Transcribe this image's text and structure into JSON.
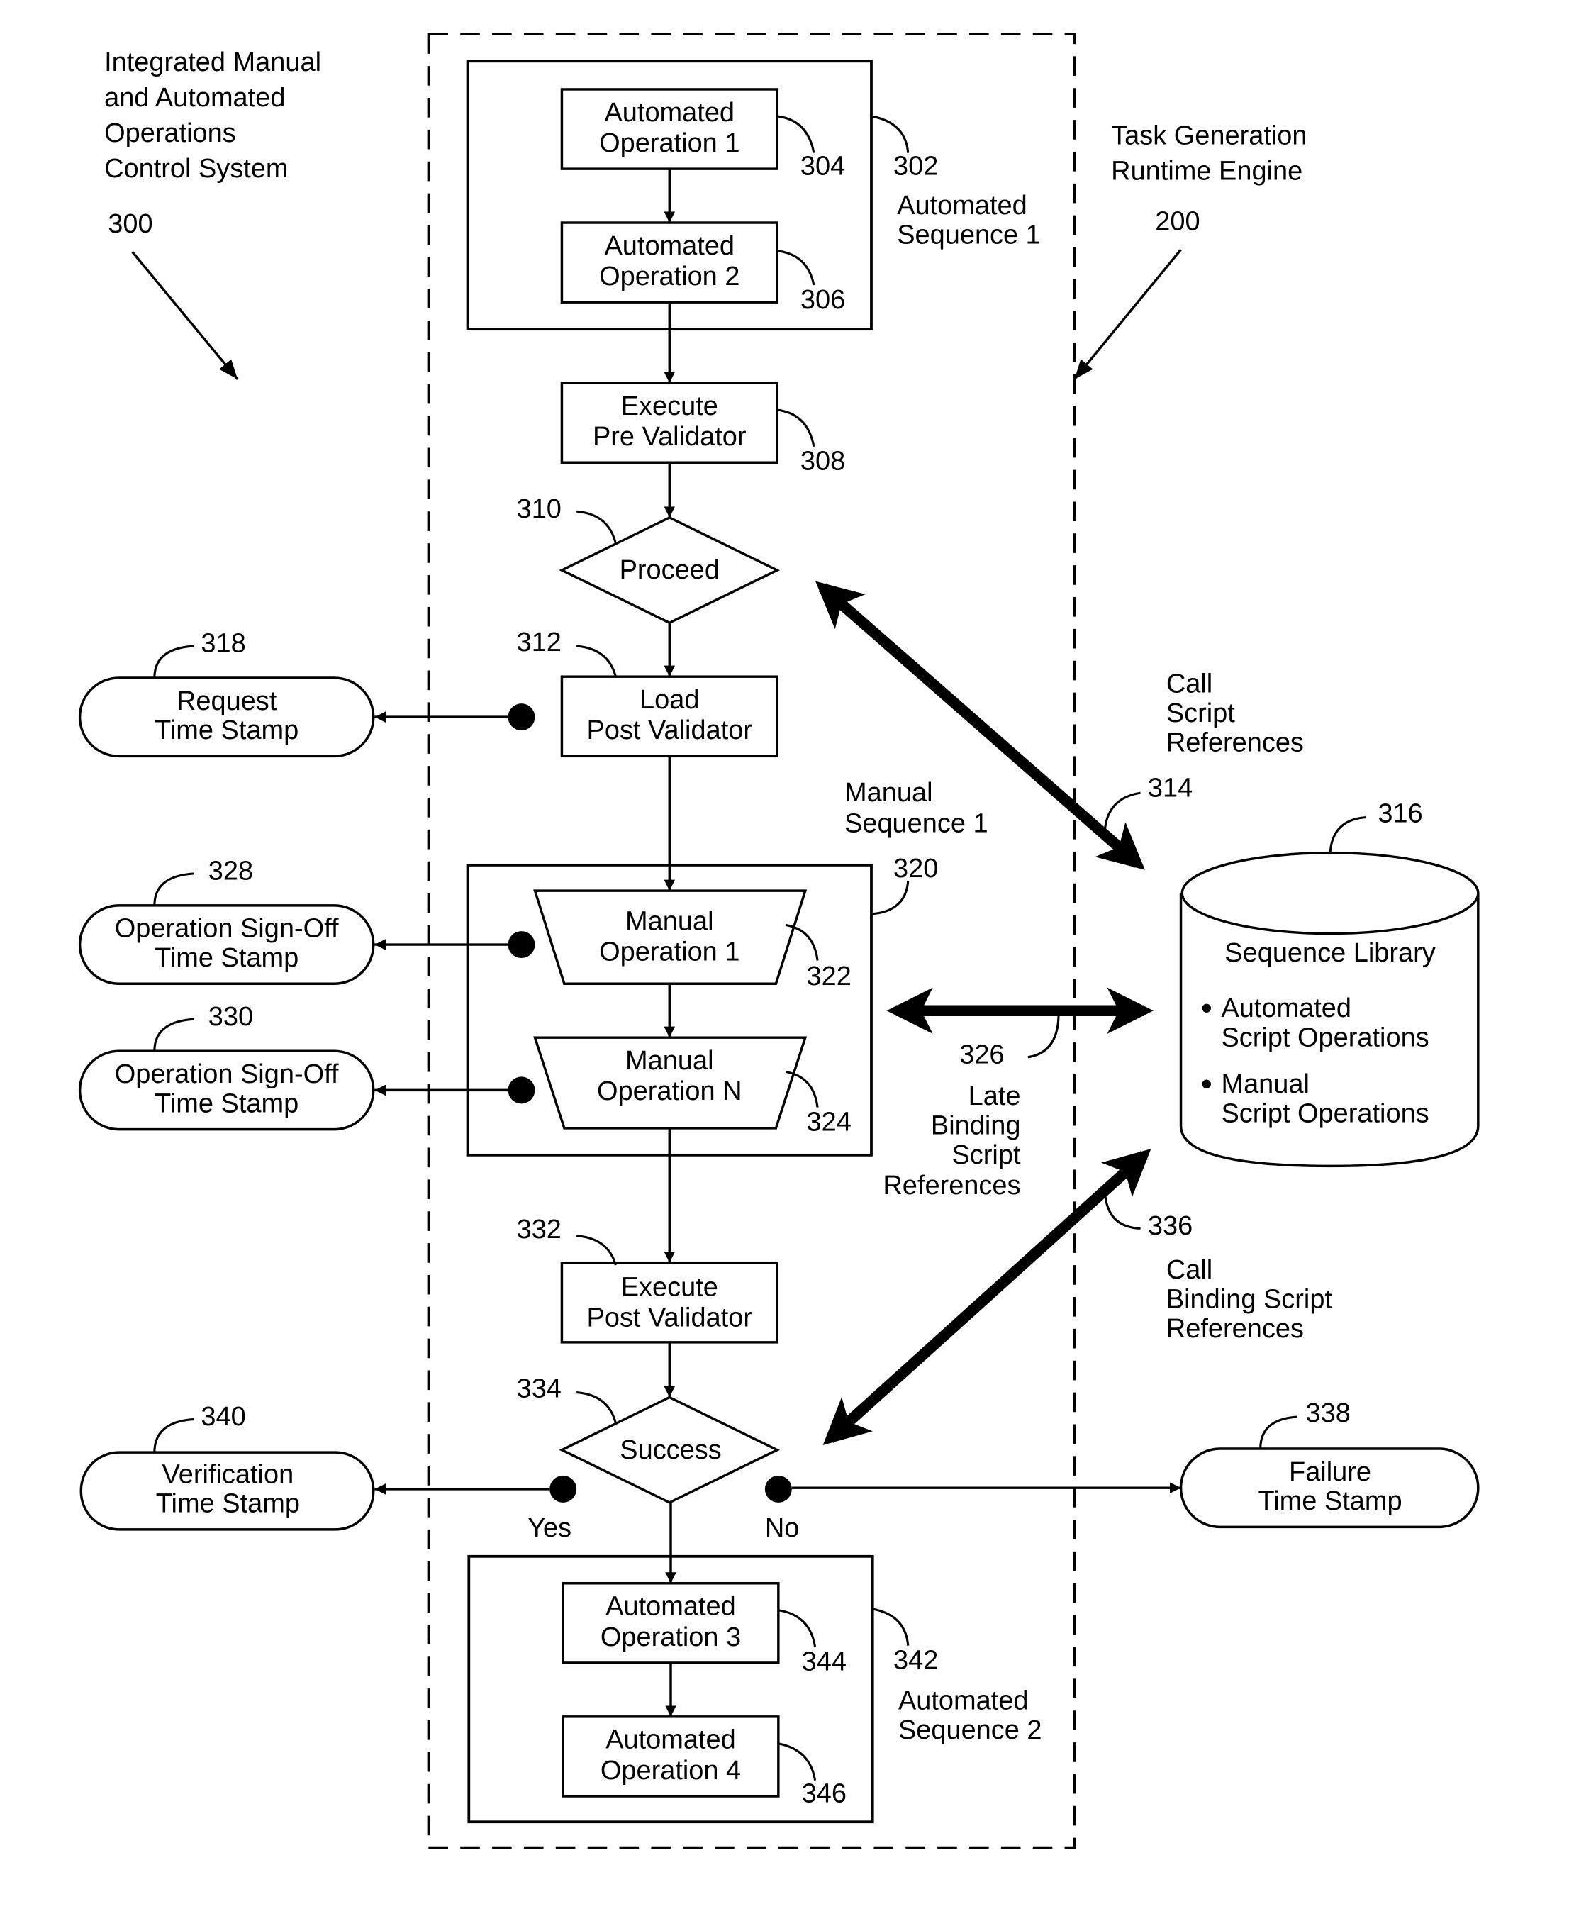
{
  "system_label": {
    "lines": [
      "Integrated Manual",
      "and Automated",
      "Operations",
      "Control System"
    ],
    "ref": "300"
  },
  "engine_label": {
    "lines": [
      "Task Generation",
      "Runtime Engine"
    ],
    "ref": "200"
  },
  "automated_sequence_1": {
    "ref": "302",
    "caption": [
      "Automated",
      "Sequence 1"
    ],
    "op1": {
      "lines": [
        "Automated",
        "Operation 1"
      ],
      "ref": "304"
    },
    "op2": {
      "lines": [
        "Automated",
        "Operation 2"
      ],
      "ref": "306"
    }
  },
  "pre_validator": {
    "lines": [
      "Execute",
      "Pre Validator"
    ],
    "ref": "308"
  },
  "proceed_decision": {
    "label": "Proceed",
    "ref": "310"
  },
  "load_post_validator": {
    "lines": [
      "Load",
      "Post Validator"
    ],
    "ref": "312"
  },
  "call_script_refs": {
    "lines": [
      "Call",
      "Script",
      "References"
    ],
    "ref": "314"
  },
  "sequence_library": {
    "ref": "316",
    "title": "Sequence Library",
    "bullets": [
      [
        "Automated",
        "Script Operations"
      ],
      [
        "Manual",
        "Script Operations"
      ]
    ]
  },
  "request_time_stamp": {
    "lines": [
      "Request",
      "Time Stamp"
    ],
    "ref": "318"
  },
  "manual_sequence_1": {
    "ref": "320",
    "caption": [
      "Manual",
      "Sequence 1"
    ],
    "op1": {
      "lines": [
        "Manual",
        "Operation 1"
      ],
      "ref": "322"
    },
    "opN": {
      "lines": [
        "Manual",
        "Operation N"
      ],
      "ref": "324"
    }
  },
  "late_binding_refs": {
    "lines": [
      "Late",
      "Binding",
      "Script",
      "References"
    ],
    "ref": "326"
  },
  "signoff_1": {
    "lines": [
      "Operation Sign-Off",
      "Time Stamp"
    ],
    "ref": "328"
  },
  "signoff_n": {
    "lines": [
      "Operation Sign-Off",
      "Time Stamp"
    ],
    "ref": "330"
  },
  "execute_post_validator": {
    "lines": [
      "Execute",
      "Post Validator"
    ],
    "ref": "332"
  },
  "success_decision": {
    "label": "Success",
    "ref": "334",
    "yes": "Yes",
    "no": "No"
  },
  "call_binding_refs": {
    "lines": [
      "Call",
      "Binding Script",
      "References"
    ],
    "ref": "336"
  },
  "failure_time_stamp": {
    "lines": [
      "Failure",
      "Time Stamp"
    ],
    "ref": "338"
  },
  "verification_time_stamp": {
    "lines": [
      "Verification",
      "Time Stamp"
    ],
    "ref": "340"
  },
  "automated_sequence_2": {
    "ref": "342",
    "caption": [
      "Automated",
      "Sequence 2"
    ],
    "op3": {
      "lines": [
        "Automated",
        "Operation 3"
      ],
      "ref": "344"
    },
    "op4": {
      "lines": [
        "Automated",
        "Operation 4"
      ],
      "ref": "346"
    }
  }
}
